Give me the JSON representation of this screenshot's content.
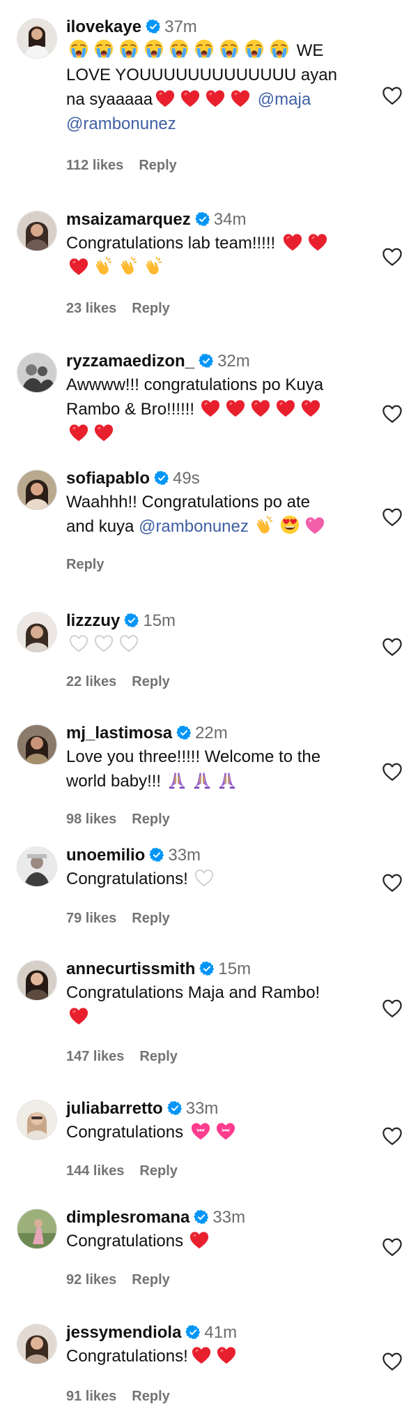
{
  "comments": [
    {
      "user": "ilovekaye",
      "time": "37m",
      "text1": "WE",
      "text2": "LOVE YOUUUUUUUUUUUUU ayan",
      "text3": "na syaaaaa",
      "mention1": "@maja",
      "mention2": "@rambonunez",
      "likes": "112 likes",
      "reply": "Reply",
      "emoji": [
        "loudly-crying-face-emoji",
        "red-heart-emoji"
      ]
    },
    {
      "user": "msaizamarquez",
      "time": "34m",
      "text1": "Congratulations lab team!!!!!",
      "likes": "23 likes",
      "reply": "Reply",
      "emoji": [
        "red-heart-emoji",
        "clapping-hands-emoji"
      ]
    },
    {
      "user": "ryzzamaedizon_",
      "time": "32m",
      "text1": "Awwww!!! congratulations po Kuya",
      "text2": "Rambo & Bro!!!!!!",
      "emoji": [
        "red-heart-emoji"
      ]
    },
    {
      "user": "sofiapablo",
      "time": "49s",
      "text1": "Waahhh!! Congratulations po ate",
      "text2": "and kuya",
      "mention1": "@rambonunez",
      "reply": "Reply",
      "emoji": [
        "clapping-hands-emoji",
        "smiling-face-with-heart-eyes-emoji",
        "pink-heart-emoji"
      ]
    },
    {
      "user": "lizzzuy",
      "time": "15m",
      "likes": "22 likes",
      "reply": "Reply",
      "emoji": [
        "white-heart-emoji"
      ]
    },
    {
      "user": "mj_lastimosa",
      "time": "22m",
      "text1": "Love you three!!!!! Welcome to the",
      "text2": "world baby!!!",
      "likes": "98 likes",
      "reply": "Reply",
      "emoji": [
        "folded-hands-emoji"
      ]
    },
    {
      "user": "unoemilio",
      "time": "33m",
      "text1": "Congratulations!",
      "likes": "79 likes",
      "reply": "Reply",
      "emoji": [
        "white-heart-emoji"
      ]
    },
    {
      "user": "annecurtissmith",
      "time": "15m",
      "text1": "Congratulations Maja and Rambo!",
      "likes": "147 likes",
      "reply": "Reply",
      "emoji": [
        "red-heart-emoji"
      ]
    },
    {
      "user": "juliabarretto",
      "time": "33m",
      "text1": "Congratulations",
      "likes": "144 likes",
      "reply": "Reply",
      "emoji": [
        "heart-with-ribbon-emoji"
      ]
    },
    {
      "user": "dimplesromana",
      "time": "33m",
      "text1": "Congratulations",
      "likes": "92 likes",
      "reply": "Reply",
      "emoji": [
        "red-heart-emoji"
      ]
    },
    {
      "user": "jessymendiola",
      "time": "41m",
      "text1": "Congratulations!",
      "likes": "91 likes",
      "reply": "Reply",
      "emoji": [
        "red-heart-emoji"
      ]
    }
  ],
  "colors": {
    "verified_badge": "#0095f6",
    "mention": "#3f5fa3",
    "meta_text": "#737373",
    "red_heart": "#e8202e"
  }
}
